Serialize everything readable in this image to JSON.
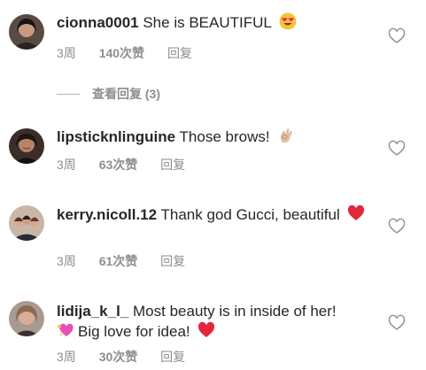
{
  "comments": [
    {
      "username": "cionna0001",
      "text": "She is BEAUTIFUL",
      "emoji": "heart-eyes-emoji",
      "time": "3周",
      "likes": "140次赞",
      "reply": "回复"
    },
    {
      "username": "lipsticknlinguine",
      "text": "Those brows!",
      "emoji": "ok-hand-emoji",
      "time": "3周",
      "likes": "63次赞",
      "reply": "回复"
    },
    {
      "username": "kerry.nicoll.12",
      "text": "Thank god Gucci, beautiful",
      "emoji": "red-heart-emoji",
      "time": "3周",
      "likes": "61次赞",
      "reply": "回复"
    },
    {
      "username": "lidija_k_l_",
      "text": "Most beauty is in inside of her!",
      "text2": "Big love for idea!",
      "emoji_lead": "sparkling-heart-emoji",
      "emoji": "red-heart-emoji",
      "time": "3周",
      "likes": "30次赞",
      "reply": "回复"
    }
  ],
  "view_replies": "查看回复 (3)",
  "colors": {
    "text": "#262626",
    "meta": "#8e8e8e",
    "heart_red": "#e0245e"
  }
}
